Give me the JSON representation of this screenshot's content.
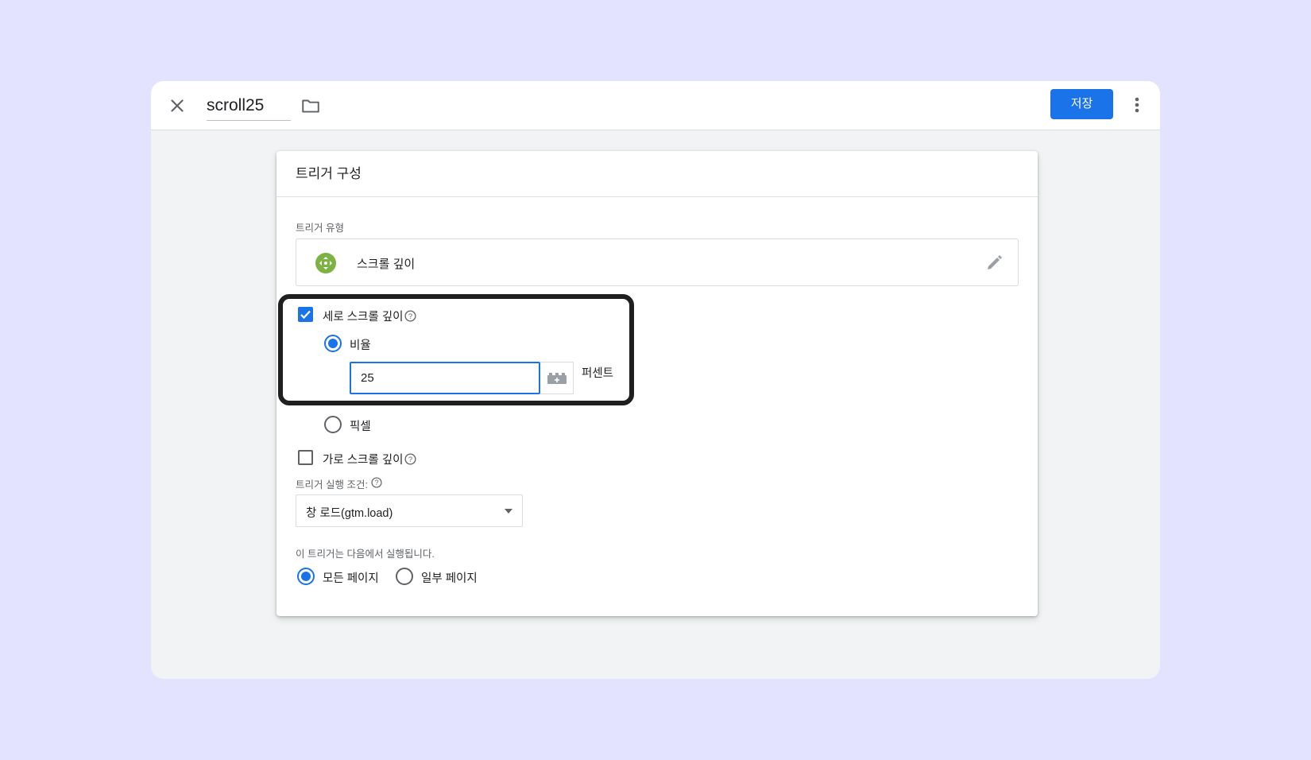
{
  "header": {
    "title": "scroll25",
    "save_label": "저장",
    "icons": [
      "close-icon",
      "folder-icon",
      "more-vert-icon"
    ]
  },
  "card": {
    "title": "트리거 구성",
    "trigger_type_label": "트리거 유형",
    "trigger_type_name": "스크롤 깊이",
    "trigger_type_icon_color": "#7cb342",
    "vertical": {
      "label": "세로 스크롤 깊이",
      "checked": true,
      "percent_label": "비율",
      "percent_value": "25",
      "percent_unit": "퍼센트",
      "pixel_label": "픽셀"
    },
    "horizontal": {
      "label": "가로 스크롤 깊이",
      "checked": false
    },
    "fire_on_label": "트리거 실행 조건:",
    "fire_on_value": "창 로드(gtm.load)",
    "scope_label": "이 트리거는 다음에서 실행됩니다.",
    "scope_all": "모든 페이지",
    "scope_some": "일부 페이지"
  },
  "colors": {
    "accent": "#1a73e8",
    "background": "#e3e3ff",
    "highlight_border": "#1f1f1f"
  }
}
